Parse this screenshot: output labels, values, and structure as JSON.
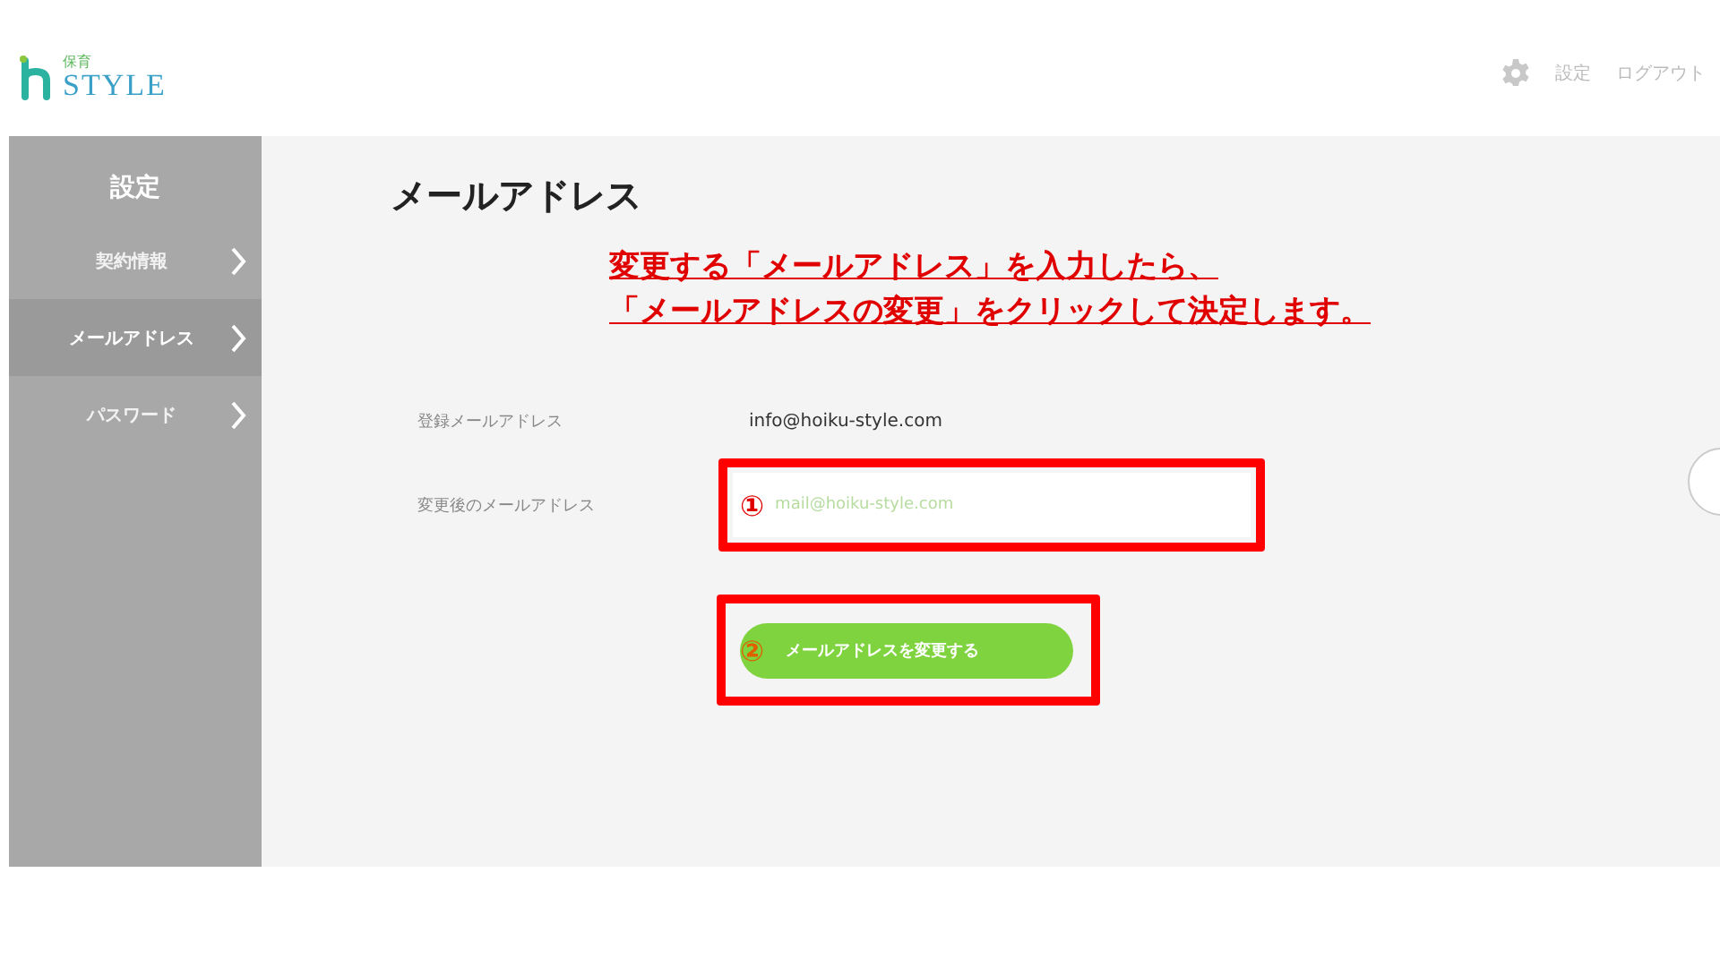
{
  "logo": {
    "small": "保育",
    "main": "STYLE"
  },
  "header": {
    "settings": "設定",
    "logout": "ログアウト"
  },
  "sidebar": {
    "title": "設定",
    "items": [
      {
        "label": "契約情報",
        "selected": false
      },
      {
        "label": "メールアドレス",
        "selected": true
      },
      {
        "label": "パスワード",
        "selected": false
      }
    ]
  },
  "page_title": "メールアドレス",
  "annotation": [
    "変更する「メールアドレス」を入力したら、",
    "「メールアドレスの変更」をクリックして決定します。"
  ],
  "current_email": {
    "label": "登録メールアドレス",
    "value": "info@hoiku-style.com"
  },
  "new_email": {
    "label": "変更後のメールアドレス",
    "marker": "①",
    "placeholder": "mail@hoiku-style.com"
  },
  "submit": {
    "marker": "②",
    "label": "メールアドレスを変更する"
  }
}
